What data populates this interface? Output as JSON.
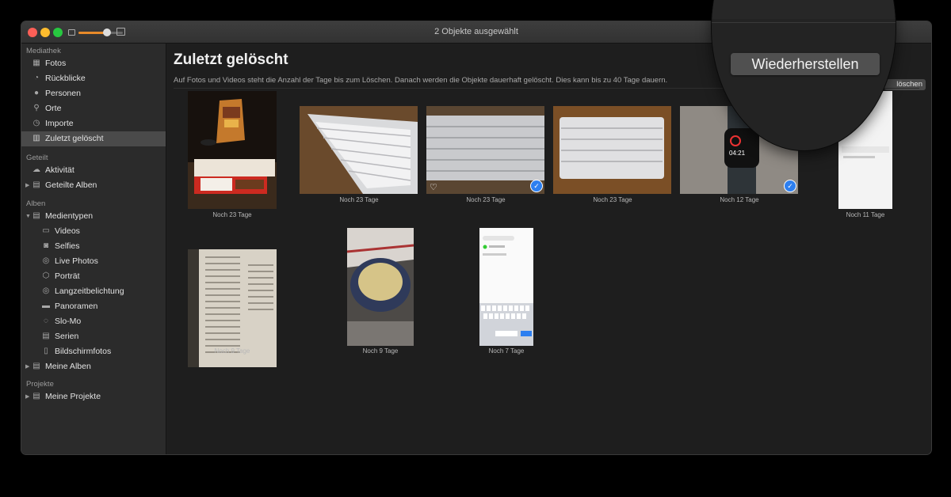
{
  "window": {
    "title": "2 Objekte ausgewählt"
  },
  "zoom": {
    "level": 0.75
  },
  "sidebar": {
    "sections": [
      {
        "label": "Mediathek"
      },
      {
        "label": "Geteilt"
      },
      {
        "label": "Alben"
      },
      {
        "label": "Projekte"
      }
    ],
    "items": [
      {
        "label": "Fotos",
        "icon": "photos-icon"
      },
      {
        "label": "Rückblicke",
        "icon": "memories-icon"
      },
      {
        "label": "Personen",
        "icon": "person-icon"
      },
      {
        "label": "Orte",
        "icon": "pin-icon"
      },
      {
        "label": "Importe",
        "icon": "clock-icon"
      },
      {
        "label": "Zuletzt gelöscht",
        "icon": "trash-icon",
        "selected": true
      },
      {
        "label": "Aktivität",
        "icon": "cloud-icon"
      },
      {
        "label": "Geteilte Alben",
        "icon": "folder-icon"
      },
      {
        "label": "Medientypen",
        "icon": "folder-icon"
      },
      {
        "label": "Videos",
        "icon": "video-icon"
      },
      {
        "label": "Selfies",
        "icon": "camera-icon"
      },
      {
        "label": "Live Photos",
        "icon": "live-photo-icon"
      },
      {
        "label": "Porträt",
        "icon": "cube-icon"
      },
      {
        "label": "Langzeitbelichtung",
        "icon": "long-exposure-icon"
      },
      {
        "label": "Panoramen",
        "icon": "panorama-icon"
      },
      {
        "label": "Slo-Mo",
        "icon": "slomo-icon"
      },
      {
        "label": "Serien",
        "icon": "burst-icon"
      },
      {
        "label": "Bildschirmfotos",
        "icon": "phone-icon"
      },
      {
        "label": "Meine Alben",
        "icon": "folder-icon"
      },
      {
        "label": "Meine Projekte",
        "icon": "folder-icon"
      }
    ]
  },
  "main": {
    "title": "Zuletzt gelöscht",
    "description": "Auf Fotos und Videos steht die Anzahl der Tage bis zum Löschen. Danach werden die Objekte dauerhaft gelöscht. Dies kann bis zu 40 Tage dauern.",
    "delete_label": "löschen",
    "restore_label": "Wiederherstellen",
    "photos": [
      {
        "caption": "Noch 23 Tage",
        "subject": "snacks",
        "selected": false
      },
      {
        "caption": "Noch 23 Tage",
        "subject": "keyboard",
        "selected": false
      },
      {
        "caption": "Noch 23 Tage",
        "subject": "keyboard",
        "selected": true,
        "favorite": true
      },
      {
        "caption": "Noch 23 Tage",
        "subject": "keyboard",
        "selected": false
      },
      {
        "caption": "Noch 12 Tage",
        "subject": "watch",
        "selected": true,
        "watch_time": "04:21:02 00 03"
      },
      {
        "caption": "Noch 11 Tage",
        "subject": "screenshot",
        "selected": false
      },
      {
        "caption": "Noch 9 Tage",
        "subject": "newspaper",
        "selected": false
      },
      {
        "caption": "Noch 9 Tage",
        "subject": "dough",
        "selected": false
      },
      {
        "caption": "Noch 7 Tage",
        "subject": "screenshot",
        "selected": false
      }
    ]
  },
  "colors": {
    "accent": "#e88a2a",
    "selection": "#2d7ff0"
  }
}
